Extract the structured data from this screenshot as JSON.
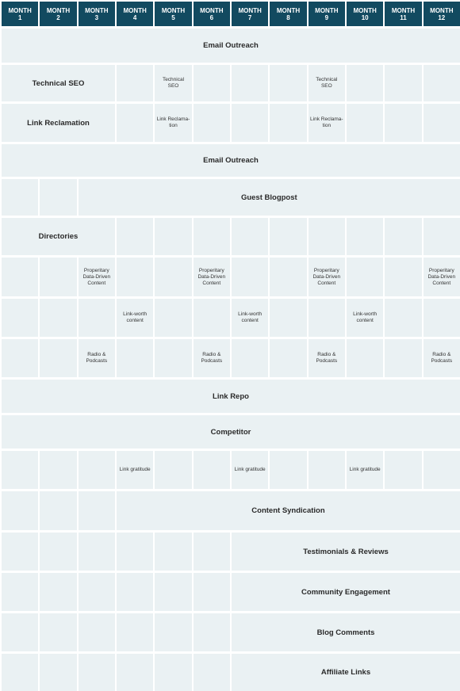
{
  "colors": {
    "header_bg": "#124a60",
    "header_text": "#ffffff",
    "cell_bg": "#eaf1f3",
    "cell_text": "#222222"
  },
  "header": {
    "months": [
      {
        "line1": "MONTH",
        "line2": "1"
      },
      {
        "line1": "MONTH",
        "line2": "2"
      },
      {
        "line1": "MONTH",
        "line2": "3"
      },
      {
        "line1": "MONTH",
        "line2": "4"
      },
      {
        "line1": "MONTH",
        "line2": "5"
      },
      {
        "line1": "MONTH",
        "line2": "6"
      },
      {
        "line1": "MONTH",
        "line2": "7"
      },
      {
        "line1": "MONTH",
        "line2": "8"
      },
      {
        "line1": "MONTH",
        "line2": "9"
      },
      {
        "line1": "MONTH",
        "line2": "10"
      },
      {
        "line1": "MONTH",
        "line2": "11"
      },
      {
        "line1": "MONTH",
        "line2": "12"
      }
    ]
  },
  "rows": [
    {
      "name": "email-outreach-1",
      "cells": [
        {
          "span": 12,
          "text": "Email Outreach",
          "size": "big"
        }
      ]
    },
    {
      "name": "technical-seo",
      "cells": [
        {
          "span": 3,
          "text": "Technical SEO",
          "size": "big"
        },
        {
          "span": 1,
          "text": ""
        },
        {
          "span": 1,
          "text": "Technical SEO",
          "size": "small"
        },
        {
          "span": 1,
          "text": ""
        },
        {
          "span": 1,
          "text": ""
        },
        {
          "span": 1,
          "text": ""
        },
        {
          "span": 1,
          "text": "Technical SEO",
          "size": "small"
        },
        {
          "span": 1,
          "text": ""
        },
        {
          "span": 1,
          "text": ""
        },
        {
          "span": 1,
          "text": ""
        }
      ]
    },
    {
      "name": "link-reclamation",
      "cells": [
        {
          "span": 3,
          "text": "Link Reclamation",
          "size": "big"
        },
        {
          "span": 1,
          "text": ""
        },
        {
          "span": 1,
          "text": "Link Reclama-tion",
          "size": "small"
        },
        {
          "span": 1,
          "text": ""
        },
        {
          "span": 1,
          "text": ""
        },
        {
          "span": 1,
          "text": ""
        },
        {
          "span": 1,
          "text": "Link Reclama-tion",
          "size": "small"
        },
        {
          "span": 1,
          "text": ""
        },
        {
          "span": 1,
          "text": ""
        },
        {
          "span": 1,
          "text": ""
        }
      ]
    },
    {
      "name": "email-outreach-2",
      "cells": [
        {
          "span": 12,
          "text": "Email Outreach",
          "size": "big"
        }
      ]
    },
    {
      "name": "guest-blogpost",
      "cells": [
        {
          "span": 1,
          "text": ""
        },
        {
          "span": 1,
          "text": ""
        },
        {
          "span": 10,
          "text": "Guest Blogpost",
          "size": "big"
        }
      ]
    },
    {
      "name": "directories",
      "cells": [
        {
          "span": 3,
          "text": "Directories",
          "size": "big"
        },
        {
          "span": 1,
          "text": ""
        },
        {
          "span": 1,
          "text": ""
        },
        {
          "span": 1,
          "text": ""
        },
        {
          "span": 1,
          "text": ""
        },
        {
          "span": 1,
          "text": ""
        },
        {
          "span": 1,
          "text": ""
        },
        {
          "span": 1,
          "text": ""
        },
        {
          "span": 1,
          "text": ""
        },
        {
          "span": 1,
          "text": ""
        }
      ]
    },
    {
      "name": "proprietary-content",
      "cells": [
        {
          "span": 1,
          "text": ""
        },
        {
          "span": 1,
          "text": ""
        },
        {
          "span": 1,
          "text": "Properitary Data-Driven Content",
          "size": "small"
        },
        {
          "span": 1,
          "text": ""
        },
        {
          "span": 1,
          "text": ""
        },
        {
          "span": 1,
          "text": "Properitary Data-Driven Content",
          "size": "small"
        },
        {
          "span": 1,
          "text": ""
        },
        {
          "span": 1,
          "text": ""
        },
        {
          "span": 1,
          "text": "Properitary Data-Driven Content",
          "size": "small"
        },
        {
          "span": 1,
          "text": ""
        },
        {
          "span": 1,
          "text": ""
        },
        {
          "span": 1,
          "text": "Properitary Data-Driven Content",
          "size": "small"
        }
      ]
    },
    {
      "name": "link-worth-content",
      "cells": [
        {
          "span": 1,
          "text": ""
        },
        {
          "span": 1,
          "text": ""
        },
        {
          "span": 1,
          "text": ""
        },
        {
          "span": 1,
          "text": "Link-worth content",
          "size": "small"
        },
        {
          "span": 1,
          "text": ""
        },
        {
          "span": 1,
          "text": ""
        },
        {
          "span": 1,
          "text": "Link-worth content",
          "size": "small"
        },
        {
          "span": 1,
          "text": ""
        },
        {
          "span": 1,
          "text": ""
        },
        {
          "span": 1,
          "text": "Link-worth content",
          "size": "small"
        },
        {
          "span": 1,
          "text": ""
        },
        {
          "span": 1,
          "text": ""
        }
      ]
    },
    {
      "name": "radio-podcasts",
      "cells": [
        {
          "span": 1,
          "text": ""
        },
        {
          "span": 1,
          "text": ""
        },
        {
          "span": 1,
          "text": "Radio & Podcasts",
          "size": "small"
        },
        {
          "span": 1,
          "text": ""
        },
        {
          "span": 1,
          "text": ""
        },
        {
          "span": 1,
          "text": "Radio & Podcasts",
          "size": "small"
        },
        {
          "span": 1,
          "text": ""
        },
        {
          "span": 1,
          "text": ""
        },
        {
          "span": 1,
          "text": "Radio & Podcasts",
          "size": "small"
        },
        {
          "span": 1,
          "text": ""
        },
        {
          "span": 1,
          "text": ""
        },
        {
          "span": 1,
          "text": "Radio & Podcasts",
          "size": "small"
        }
      ]
    },
    {
      "name": "link-repo",
      "cells": [
        {
          "span": 12,
          "text": "Link Repo",
          "size": "big"
        }
      ]
    },
    {
      "name": "competitor",
      "cells": [
        {
          "span": 12,
          "text": "Competitor",
          "size": "big"
        }
      ]
    },
    {
      "name": "link-gratitude",
      "cells": [
        {
          "span": 1,
          "text": ""
        },
        {
          "span": 1,
          "text": ""
        },
        {
          "span": 1,
          "text": ""
        },
        {
          "span": 1,
          "text": "Link gratitude",
          "size": "small"
        },
        {
          "span": 1,
          "text": ""
        },
        {
          "span": 1,
          "text": ""
        },
        {
          "span": 1,
          "text": "Link gratitude",
          "size": "small"
        },
        {
          "span": 1,
          "text": ""
        },
        {
          "span": 1,
          "text": ""
        },
        {
          "span": 1,
          "text": "Link gratitude",
          "size": "small"
        },
        {
          "span": 1,
          "text": ""
        },
        {
          "span": 1,
          "text": ""
        }
      ]
    },
    {
      "name": "content-syndication",
      "cells": [
        {
          "span": 1,
          "text": ""
        },
        {
          "span": 1,
          "text": ""
        },
        {
          "span": 1,
          "text": ""
        },
        {
          "span": 9,
          "text": "Content Syndication",
          "size": "big"
        }
      ]
    },
    {
      "name": "testimonials-reviews",
      "cells": [
        {
          "span": 1,
          "text": ""
        },
        {
          "span": 1,
          "text": ""
        },
        {
          "span": 1,
          "text": ""
        },
        {
          "span": 1,
          "text": ""
        },
        {
          "span": 1,
          "text": ""
        },
        {
          "span": 1,
          "text": ""
        },
        {
          "span": 6,
          "text": "Testimonials & Reviews",
          "size": "big"
        }
      ]
    },
    {
      "name": "community-engagement",
      "cells": [
        {
          "span": 1,
          "text": ""
        },
        {
          "span": 1,
          "text": ""
        },
        {
          "span": 1,
          "text": ""
        },
        {
          "span": 1,
          "text": ""
        },
        {
          "span": 1,
          "text": ""
        },
        {
          "span": 1,
          "text": ""
        },
        {
          "span": 6,
          "text": "Community Engagement",
          "size": "big"
        }
      ]
    },
    {
      "name": "blog-comments",
      "cells": [
        {
          "span": 1,
          "text": ""
        },
        {
          "span": 1,
          "text": ""
        },
        {
          "span": 1,
          "text": ""
        },
        {
          "span": 1,
          "text": ""
        },
        {
          "span": 1,
          "text": ""
        },
        {
          "span": 1,
          "text": ""
        },
        {
          "span": 6,
          "text": "Blog Comments",
          "size": "big"
        }
      ]
    },
    {
      "name": "affiliate-links",
      "cells": [
        {
          "span": 1,
          "text": ""
        },
        {
          "span": 1,
          "text": ""
        },
        {
          "span": 1,
          "text": ""
        },
        {
          "span": 1,
          "text": ""
        },
        {
          "span": 1,
          "text": ""
        },
        {
          "span": 1,
          "text": ""
        },
        {
          "span": 6,
          "text": "Affiliate Links",
          "size": "big"
        }
      ]
    }
  ]
}
